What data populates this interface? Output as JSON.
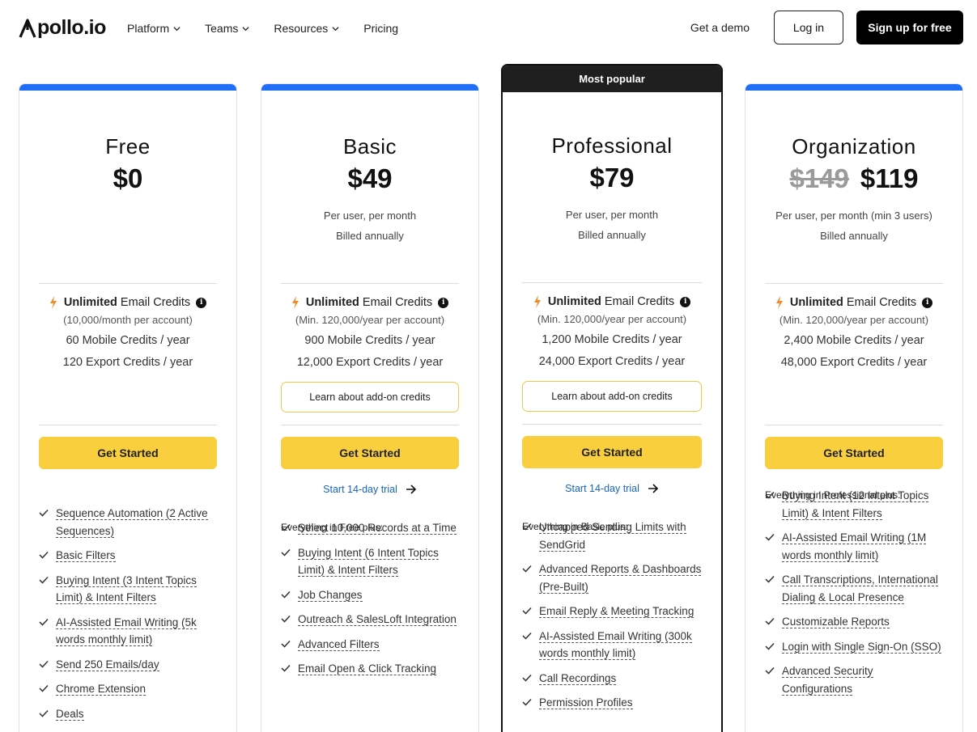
{
  "nav": {
    "logo": "pollo.io",
    "links": [
      "Platform",
      "Teams",
      "Resources",
      "Pricing"
    ],
    "demo": "Get a demo",
    "login": "Log in",
    "signup": "Sign up for free"
  },
  "colors": {
    "accent_blue": "#1f6ef7",
    "cta_yellow": "#f9cf3f",
    "trial_blue": "#1565c0"
  },
  "plans": [
    {
      "name": "Free",
      "price": "$0",
      "strike": "",
      "sub1": "",
      "sub2": "",
      "credits_bold": "Unlimited",
      "credits_rest": " Email Credits",
      "credits_note": "(10,000/month per account)",
      "mobile": "60 Mobile Credits / year",
      "export": "120 Export Credits / year",
      "addon": "",
      "cta": "Get Started",
      "trial": "",
      "everything": "",
      "features": [
        "Sequence Automation (2 Active Sequences)",
        "Basic Filters",
        "Buying Intent (3 Intent Topics Limit) & Intent Filters",
        "AI-Assisted Email Writing (5k words monthly limit)",
        "Send 250 Emails/day",
        "Chrome Extension",
        "Deals"
      ]
    },
    {
      "name": "Basic",
      "price": "$49",
      "strike": "",
      "sub1": "Per user, per month",
      "sub2": "Billed annually",
      "credits_bold": "Unlimited",
      "credits_rest": " Email Credits",
      "credits_note": "(Min. 120,000/year per account)",
      "mobile": "900 Mobile Credits / year",
      "export": "12,000 Export Credits / year",
      "addon": "Learn about add-on credits",
      "cta": "Get Started",
      "trial": "Start 14-day trial",
      "everything": "Everything in Free plus:",
      "features": [
        "Select 10,000 Records at a Time",
        "Buying Intent (6 Intent Topics Limit) & Intent Filters",
        "Job Changes",
        "Outreach & SalesLoft Integration",
        "Advanced Filters",
        "Email Open & Click Tracking"
      ]
    },
    {
      "name": "Professional",
      "price": "$79",
      "strike": "",
      "sub1": "Per user, per month",
      "sub2": "Billed annually",
      "popular": "Most popular",
      "credits_bold": "Unlimited",
      "credits_rest": " Email Credits",
      "credits_note": "(Min. 120,000/year per account)",
      "mobile": "1,200 Mobile Credits / year",
      "export": "24,000 Export Credits / year",
      "addon": "Learn about add-on credits",
      "cta": "Get Started",
      "trial": "Start 14-day trial",
      "everything": "Everything in Basic plus:",
      "features": [
        "Uncapped Sending Limits with SendGrid",
        "Advanced Reports & Dashboards (Pre-Built)",
        "Email Reply & Meeting Tracking",
        "AI-Assisted Email Writing (300k words monthly limit)",
        "Call Recordings",
        "Permission Profiles"
      ]
    },
    {
      "name": "Organization",
      "price": "$119",
      "strike": "$149",
      "sub1": "Per user, per month (min 3 users)",
      "sub2": "Billed annually",
      "credits_bold": "Unlimited",
      "credits_rest": " Email Credits",
      "credits_note": "(Min. 120,000/year per account)",
      "mobile": "2,400 Mobile Credits / year",
      "export": "48,000 Export Credits / year",
      "addon": "",
      "cta": "Get Started",
      "trial": "",
      "everything": "Everything in Professional plus:",
      "features": [
        "Buying Intent (12 Intent Topics Limit) & Intent Filters",
        "AI-Assisted Email Writing (1M words monthly limit)",
        "Call Transcriptions, International Dialing & Local Presence",
        "Customizable Reports",
        "Login with Single Sign-On (SSO)",
        "Advanced Security Configurations"
      ]
    }
  ]
}
